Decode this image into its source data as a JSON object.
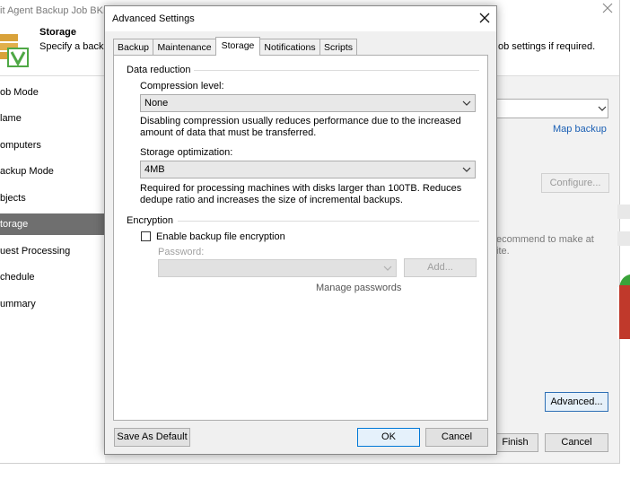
{
  "wizard": {
    "title": "it Agent Backup Job BKP",
    "step_title": "Storage",
    "step_desc_left": "Specify a backu",
    "step_desc_right": "ob settings if required.",
    "nav": [
      "ob Mode",
      "lame",
      "omputers",
      "ackup Mode",
      "bjects",
      "torage",
      "uest Processing",
      "chedule",
      "ummary"
    ],
    "nav_selected_index": 5,
    "map_backup": "Map backup",
    "configure": "Configure...",
    "hint_line1": "ecommend to make at",
    "hint_line2": "ite.",
    "advanced": "Advanced...",
    "finish": "Finish",
    "cancel": "Cancel"
  },
  "dialog": {
    "title": "Advanced Settings",
    "tabs": [
      "Backup",
      "Maintenance",
      "Storage",
      "Notifications",
      "Scripts"
    ],
    "active_tab": "Storage",
    "data_reduction": {
      "group_label": "Data reduction",
      "compression_label": "Compression level:",
      "compression_value": "None",
      "compression_note_1": "Disabling compression usually reduces performance due to the increased",
      "compression_note_2": "amount of data that must be transferred.",
      "optimization_label": "Storage optimization:",
      "optimization_value": "4MB",
      "optimization_note_1": "Required for processing machines with disks larger than 100TB. Reduces",
      "optimization_note_2": "dedupe ratio and increases the size of incremental backups."
    },
    "encryption": {
      "group_label": "Encryption",
      "checkbox_label": "Enable backup file encryption",
      "checked": false,
      "password_label": "Password:",
      "add_button": "Add...",
      "manage_passwords": "Manage passwords"
    },
    "buttons": {
      "save_default": "Save As Default",
      "ok": "OK",
      "cancel": "Cancel"
    }
  },
  "colors": {
    "selected_nav": "#6f6f6f",
    "link": "#1a5fb4",
    "default_button_border": "#0078d7"
  }
}
